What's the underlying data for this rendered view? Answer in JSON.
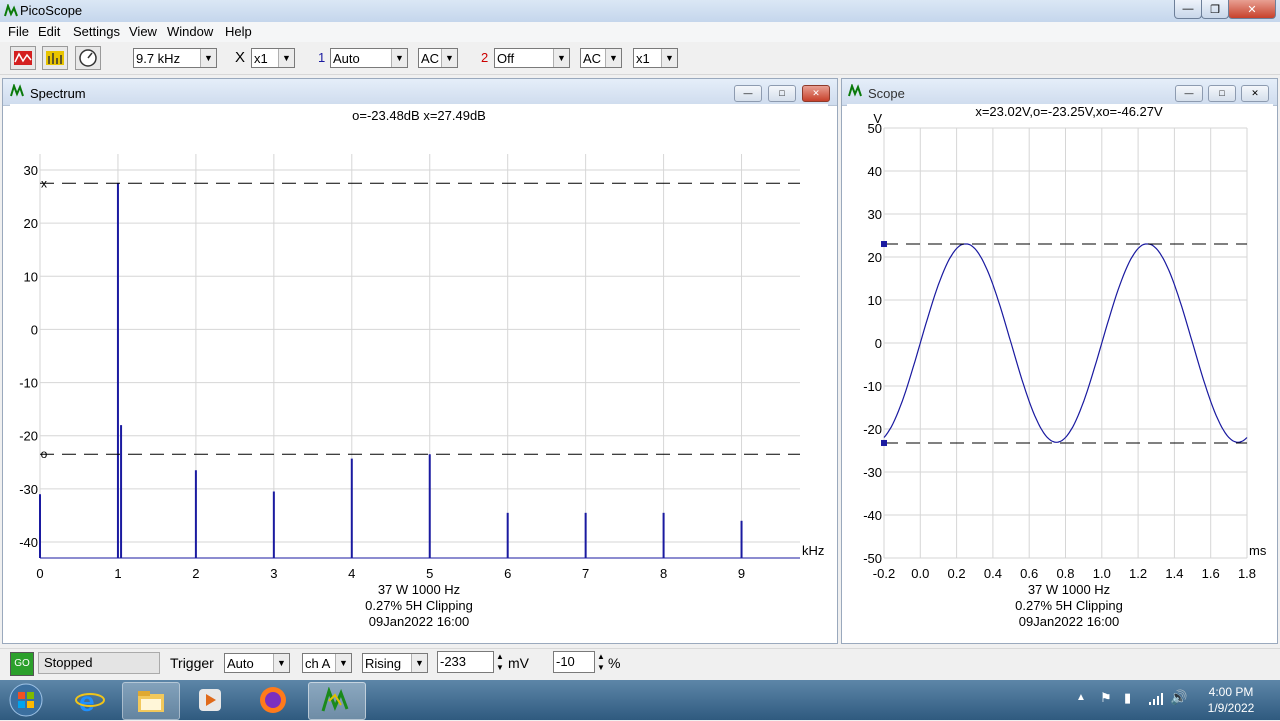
{
  "app": {
    "title": "PicoScope"
  },
  "menu": [
    "File",
    "Edit",
    "Settings",
    "View",
    "Window",
    "Help"
  ],
  "toolbar": {
    "timebase": "9.7 kHz",
    "x_label": "X",
    "multiplier": "x1",
    "ch1_num": "1",
    "ch1_range": "Auto",
    "ch1_coupling": "AC",
    "ch2_num": "2",
    "ch2_range": "Off",
    "ch2_coupling": "AC",
    "ch2_multiplier": "x1",
    "ch1_color": "#1a1aa0",
    "ch2_color": "#cc0000"
  },
  "spectrum": {
    "title": "Spectrum",
    "readout": "o=-23.48dB  x=27.49dB",
    "footer": [
      "37 W 1000 Hz",
      "0.27% 5H Clipping",
      "09Jan2022  16:00"
    ]
  },
  "scope": {
    "title": "Scope",
    "readout": "x=23.02V,o=-23.25V,xo=-46.27V",
    "footer": [
      "37 W 1000 Hz",
      "0.27% 5H Clipping",
      "09Jan2022  16:00"
    ]
  },
  "status": {
    "state": "Stopped",
    "trigger_label": "Trigger",
    "trigger_mode": "Auto",
    "trigger_channel": "ch A",
    "trigger_edge": "Rising",
    "trigger_level": "-233",
    "trigger_level_unit": "mV",
    "pretrigger": "-10",
    "pretrigger_unit": "%",
    "go_label": "GO"
  },
  "tray": {
    "time": "4:00 PM",
    "date": "1/9/2022"
  },
  "chart_data": [
    {
      "type": "line",
      "name": "Spectrum",
      "xlabel": "kHz",
      "ylabel": "",
      "xlim": [
        0,
        9.75
      ],
      "ylim": [
        -43,
        33
      ],
      "x_ticks": [
        0,
        1,
        2,
        3,
        4,
        5,
        6,
        7,
        8,
        9
      ],
      "y_ticks": [
        30,
        20,
        10,
        0,
        -10,
        -20,
        -30,
        -40
      ],
      "grid": true,
      "cursor_x": 27.49,
      "cursor_o": -23.48,
      "cursor_x_label": "x",
      "cursor_o_label": "o",
      "peaks": [
        {
          "x": 0.0,
          "y": -31
        },
        {
          "x": 1.0,
          "y": 27.49
        },
        {
          "x": 1.04,
          "y": -18
        },
        {
          "x": 2.0,
          "y": -26.5
        },
        {
          "x": 3.0,
          "y": -30.5
        },
        {
          "x": 4.0,
          "y": -24.3
        },
        {
          "x": 5.0,
          "y": -23.48
        },
        {
          "x": 6.0,
          "y": -34.5
        },
        {
          "x": 7.0,
          "y": -34.5
        },
        {
          "x": 8.0,
          "y": -34.5
        },
        {
          "x": 9.0,
          "y": -36
        }
      ],
      "color": "#1a1aa0"
    },
    {
      "type": "line",
      "name": "Scope",
      "xlabel": "ms",
      "ylabel": "V",
      "xlim": [
        -0.2,
        1.8
      ],
      "ylim": [
        -50,
        50
      ],
      "x_ticks": [
        -0.2,
        0.0,
        0.2,
        0.4,
        0.6,
        0.8,
        1.0,
        1.2,
        1.4,
        1.6,
        1.8
      ],
      "y_ticks": [
        50,
        40,
        30,
        20,
        10,
        0,
        -10,
        -20,
        -30,
        -40,
        -50
      ],
      "grid": true,
      "cursor_x": 23.02,
      "cursor_o": -23.25,
      "frequency_hz": 1000,
      "amplitude_v": 23.1,
      "peak_time_ms": 0.25,
      "color": "#1a1aa0"
    }
  ]
}
